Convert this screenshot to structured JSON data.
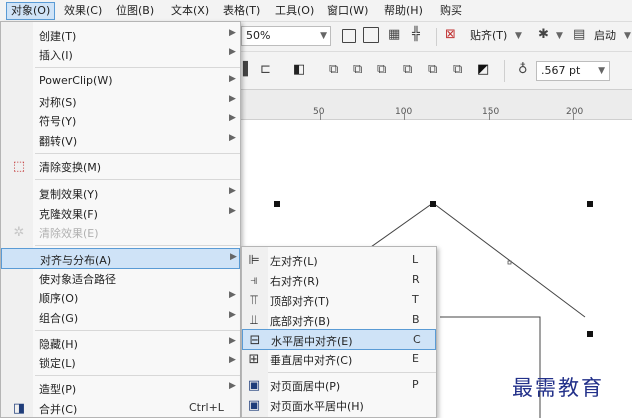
{
  "menubar": {
    "items": [
      {
        "label": "对象(O)",
        "active": true
      },
      {
        "label": "效果(C)"
      },
      {
        "label": "位图(B)"
      },
      {
        "label": "文本(X)"
      },
      {
        "label": "表格(T)"
      },
      {
        "label": "工具(O)"
      },
      {
        "label": "窗口(W)"
      },
      {
        "label": "帮助(H)"
      },
      {
        "label": "购买"
      }
    ]
  },
  "toolbar": {
    "zoom_value": "50%",
    "snap_label": "贴齐(T)",
    "launch_label": "启动",
    "outline_width": ".567 pt"
  },
  "ruler": {
    "numbers": [
      "50",
      "100",
      "150",
      "200"
    ]
  },
  "object_menu": {
    "items": [
      {
        "label": "创建(T)",
        "submenu": true
      },
      {
        "label": "插入(I)",
        "submenu": true
      },
      {
        "label": "PowerClip(W)",
        "submenu": true
      },
      {
        "label": "对称(S)",
        "submenu": true
      },
      {
        "label": "符号(Y)",
        "submenu": true
      },
      {
        "label": "翻转(V)",
        "submenu": true
      },
      {
        "label": "清除变换(M)",
        "icon": "clear-transform-icon"
      },
      {
        "label": "复制效果(Y)",
        "submenu": true
      },
      {
        "label": "克隆效果(F)",
        "submenu": true
      },
      {
        "label": "清除效果(E)",
        "disabled": true,
        "icon": "clear-effect-icon"
      },
      {
        "label": "对齐与分布(A)",
        "submenu": true,
        "highlighted": true
      },
      {
        "label": "使对象适合路径"
      },
      {
        "label": "顺序(O)",
        "submenu": true
      },
      {
        "label": "组合(G)",
        "submenu": true
      },
      {
        "label": "隐藏(H)",
        "submenu": true
      },
      {
        "label": "锁定(L)",
        "submenu": true
      },
      {
        "label": "造型(P)",
        "submenu": true
      },
      {
        "label": "合并(C)",
        "shortcut": "Ctrl+L",
        "icon": "combine-icon"
      }
    ]
  },
  "align_submenu": {
    "items": [
      {
        "label": "左对齐(L)",
        "shortcut": "L",
        "icon": "align-left-icon"
      },
      {
        "label": "右对齐(R)",
        "shortcut": "R",
        "icon": "align-right-icon"
      },
      {
        "label": "顶部对齐(T)",
        "shortcut": "T",
        "icon": "align-top-icon"
      },
      {
        "label": "底部对齐(B)",
        "shortcut": "B",
        "icon": "align-bottom-icon"
      },
      {
        "label": "水平居中对齐(E)",
        "shortcut": "C",
        "icon": "align-hcenter-icon",
        "highlighted": true
      },
      {
        "label": "垂直居中对齐(C)",
        "shortcut": "E",
        "icon": "align-vcenter-icon"
      },
      {
        "label": "对页面居中(P)",
        "shortcut": "P",
        "icon": "center-page-icon"
      },
      {
        "label": "对页面水平居中(H)",
        "shortcut": "",
        "icon": "center-page-h-icon"
      }
    ]
  },
  "watermark": "最需教育",
  "colors": {
    "highlight_bg": "#cfe3f7",
    "highlight_border": "#5a9bd5",
    "menu_bg": "#f8f8f8"
  }
}
